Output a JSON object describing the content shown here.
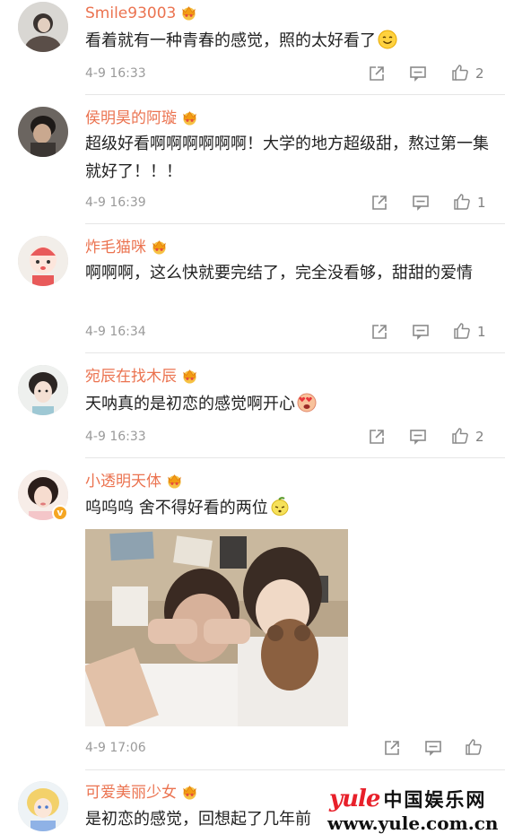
{
  "comments": [
    {
      "username": "Smile93003",
      "text": "看着就有一种青春的感觉，照的太好看了",
      "emoji": "smile-emoji",
      "time": "4-9 16:33",
      "likes": "2",
      "vip": true,
      "verified": false
    },
    {
      "username": "侯明昊的阿璇",
      "text": "超级好看啊啊啊啊啊啊！大学的地方超级甜，熬过第一集就好了！！！",
      "time": "4-9 16:39",
      "likes": "1",
      "vip": true,
      "verified": false
    },
    {
      "username": "炸毛猫咪",
      "text": "啊啊啊，这么快就要完结了，完全没看够，甜甜的爱情",
      "time": "4-9 16:34",
      "likes": "1",
      "vip": true,
      "verified": false
    },
    {
      "username": "宛辰在找木辰",
      "text": "天呐真的是初恋的感觉啊开心",
      "emoji": "heart-eyes-emoji",
      "time": "4-9 16:33",
      "likes": "2",
      "vip": true,
      "verified": false
    },
    {
      "username": "小透明天体",
      "text": "呜呜呜 舍不得好看的两位",
      "emoji": "sour-lemon-emoji",
      "time": "4-9 17:06",
      "likes": "",
      "vip": true,
      "verified": true,
      "has_photo": true
    },
    {
      "username": "可爱美丽少女",
      "text": "是初恋的感觉，回想起了几年前",
      "vip": true,
      "verified": false
    }
  ],
  "watermark": {
    "brand": "yule",
    "cn_name": "中国娱乐网",
    "url": "www.yule.com.cn"
  },
  "icons": {
    "share": "share-icon",
    "reply": "comment-icon",
    "like": "thumbs-up-icon",
    "vip": "crown-vip-icon"
  },
  "colors": {
    "username": "#eb7350",
    "text": "#222222",
    "time": "#9a9a9a",
    "divider": "#e6e6e6",
    "watermark_red": "#e8202a"
  }
}
